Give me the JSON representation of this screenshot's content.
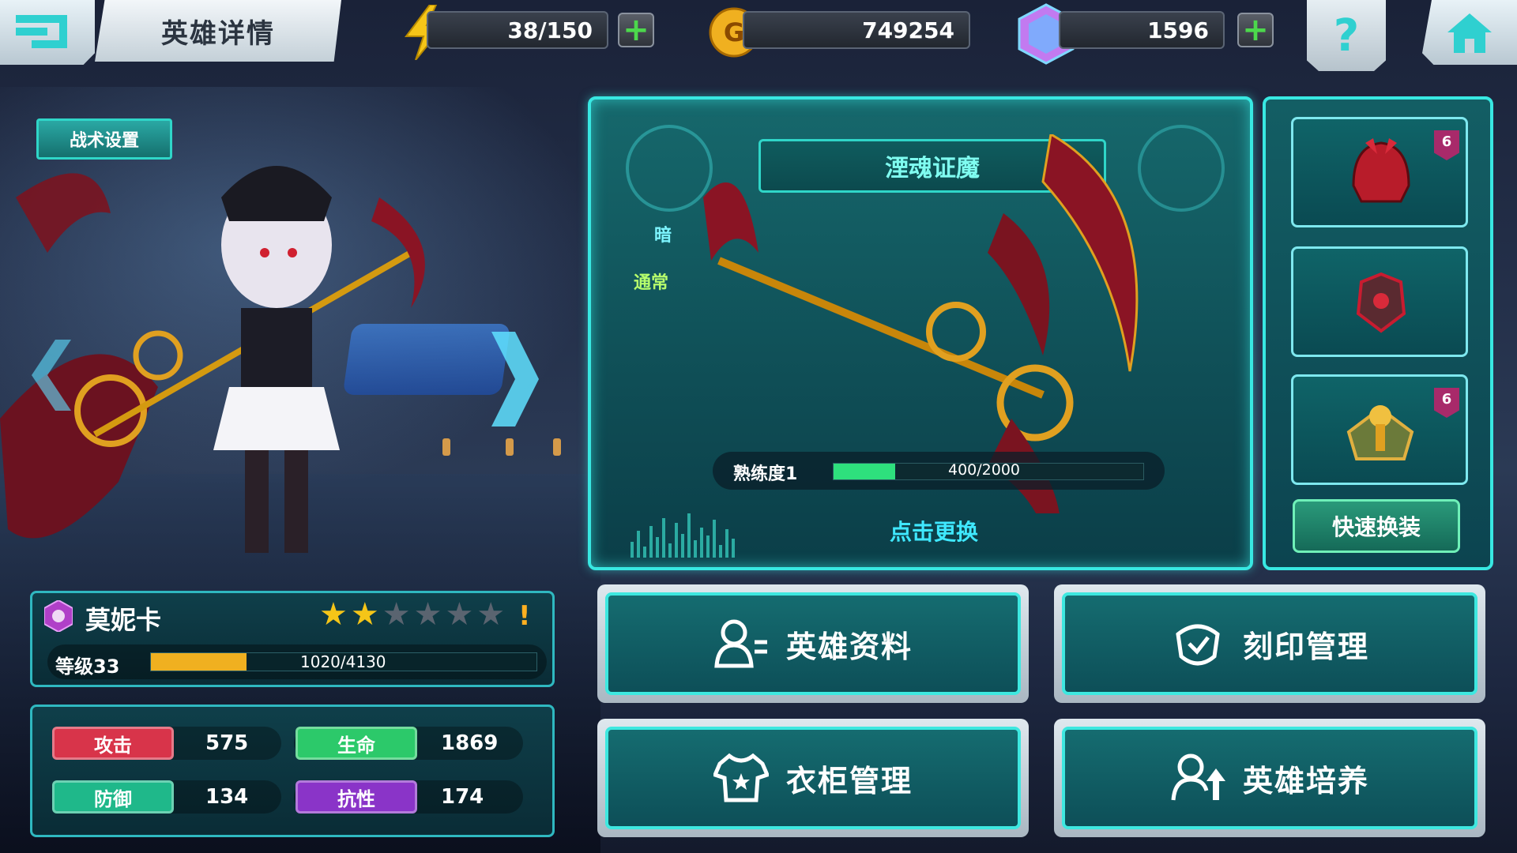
{
  "header": {
    "title": "英雄详情",
    "energy": "38/150",
    "gold": "749254",
    "gems": "1596"
  },
  "tactics_label": "战术设置",
  "weapon": {
    "name": "湮魂证魔",
    "element": "暗",
    "attack_type": "通常",
    "proficiency_label": "熟练度1",
    "proficiency_text": "400/2000",
    "proficiency_fraction": 0.2,
    "change_label": "点击更换"
  },
  "equipment": {
    "slots": [
      {
        "name": "red-helmet",
        "badge": "6"
      },
      {
        "name": "red-armor",
        "badge": ""
      },
      {
        "name": "golden-emblem",
        "badge": "6"
      }
    ],
    "quick_change_label": "快速换装"
  },
  "hero": {
    "name": "莫妮卡",
    "stars_filled": 2,
    "stars_total": 6,
    "level_label": "等级33",
    "xp_text": "1020/4130",
    "xp_fraction": 0.247
  },
  "stats": {
    "attack_label": "攻击",
    "attack_value": "575",
    "hp_label": "生命",
    "hp_value": "1869",
    "defense_label": "防御",
    "defense_value": "134",
    "resist_label": "抗性",
    "resist_value": "174"
  },
  "menu": {
    "hero_info": "英雄资料",
    "imprint": "刻印管理",
    "wardrobe": "衣柜管理",
    "train": "英雄培养"
  },
  "colors": {
    "accent_cyan": "#38e8e2",
    "attack_red": "#d8344a",
    "hp_green": "#2cc96a",
    "defense_green": "#1fb88a",
    "resist_purple": "#8a34c8",
    "xp_gold": "#f0b020",
    "proficiency_green": "#2ee07d"
  }
}
